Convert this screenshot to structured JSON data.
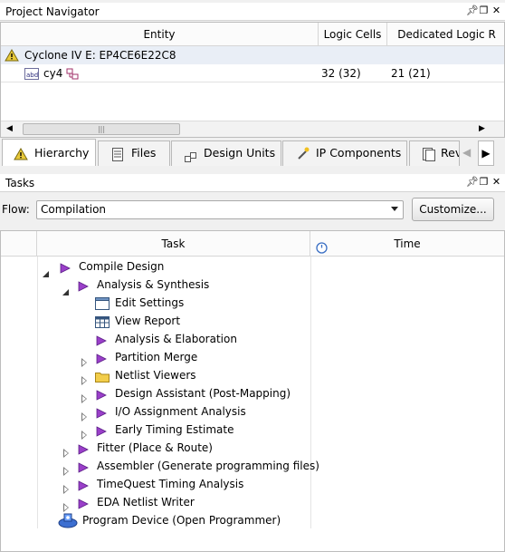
{
  "navigator": {
    "title": "Project Navigator",
    "columns": [
      "Entity",
      "Logic Cells",
      "Dedicated Logic R"
    ],
    "rows": [
      {
        "entity": "Cyclone IV E: EP4CE6E22C8",
        "logic_cells": "",
        "dedicated": ""
      },
      {
        "entity": "cy4",
        "logic_cells": "32 (32)",
        "dedicated": "21 (21)"
      }
    ],
    "tabs": [
      "Hierarchy",
      "Files",
      "Design Units",
      "IP Components",
      "Rev"
    ]
  },
  "tasks": {
    "title": "Tasks",
    "flow_label": "Flow:",
    "flow_value": "Compilation",
    "customize_label": "Customize...",
    "columns": {
      "task": "Task",
      "time": "Time"
    },
    "items": [
      {
        "label": "Compile Design"
      },
      {
        "label": "Analysis & Synthesis"
      },
      {
        "label": "Edit Settings"
      },
      {
        "label": "View Report"
      },
      {
        "label": "Analysis & Elaboration"
      },
      {
        "label": "Partition Merge"
      },
      {
        "label": "Netlist Viewers"
      },
      {
        "label": "Design Assistant (Post-Mapping)"
      },
      {
        "label": "I/O Assignment Analysis"
      },
      {
        "label": "Early Timing Estimate"
      },
      {
        "label": "Fitter (Place & Route)"
      },
      {
        "label": "Assembler (Generate programming files)"
      },
      {
        "label": "TimeQuest Timing Analysis"
      },
      {
        "label": "EDA Netlist Writer"
      },
      {
        "label": "Program Device (Open Programmer)"
      }
    ]
  },
  "colors": {
    "task_arrow": "#9a3fc9",
    "selection": "#dde8f6"
  }
}
